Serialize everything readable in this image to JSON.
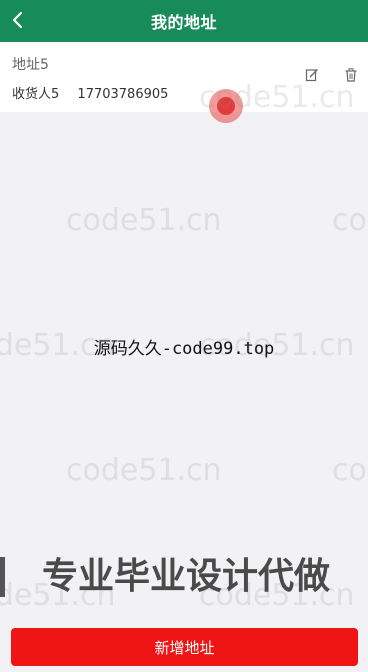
{
  "header": {
    "title": "我的地址",
    "back_icon": "chevron-left-icon"
  },
  "address": {
    "name": "地址5",
    "receiver": "收货人5",
    "phone": "17703786905",
    "edit_icon": "edit-icon",
    "delete_icon": "trash-icon"
  },
  "watermarks": {
    "site": "code51.cn",
    "center_text": "源码久久-code99.top",
    "banner": "专业毕业设计代做"
  },
  "footer": {
    "add_button_label": "新增地址"
  },
  "colors": {
    "header": "#188b5a",
    "add_button": "#f01515",
    "background": "#f2f2f4"
  }
}
